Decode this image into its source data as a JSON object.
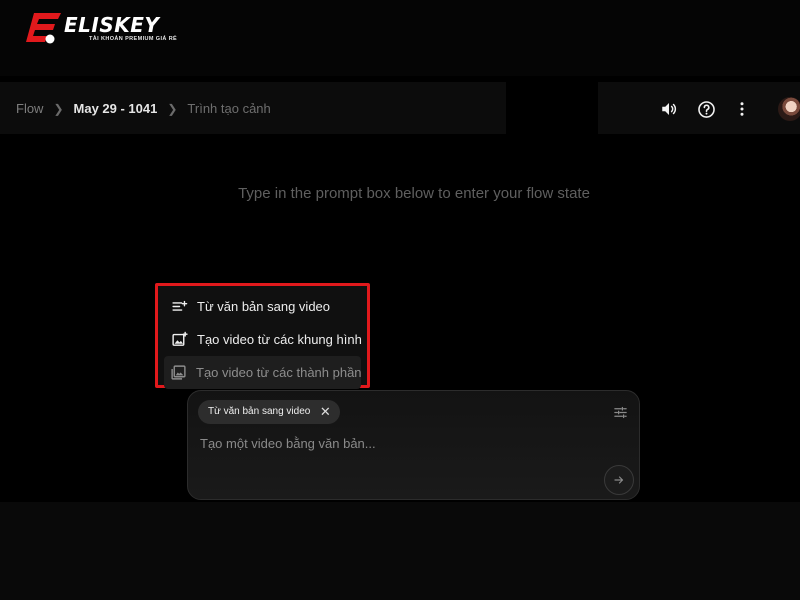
{
  "watermark": {
    "brand": "ELISKEY",
    "tagline": "TÀI KHOẢN PREMIUM GIÁ RẺ"
  },
  "breadcrumb": {
    "root": "Flow",
    "project": "May 29 - 1041",
    "page": "Trình tạo cảnh"
  },
  "header_icons": [
    "volume-icon",
    "help-icon",
    "more-vert-icon"
  ],
  "hint": "Type in the prompt box below to enter your flow state",
  "mode_menu": {
    "items": [
      {
        "label": "Từ văn bản sang video",
        "icon": "text-to-video-icon"
      },
      {
        "label": "Tạo video từ các khung hình",
        "icon": "frames-to-video-icon"
      },
      {
        "label": "Tạo video từ các thành phần",
        "icon": "ingredients-to-video-icon"
      }
    ],
    "highlight_color": "#e1191c"
  },
  "prompt_box": {
    "chip_label": "Từ văn bản sang video",
    "placeholder": "Tạo một video bằng văn bản...",
    "value": ""
  },
  "colors": {
    "background": "#000000",
    "accent_red": "#e1191c"
  }
}
